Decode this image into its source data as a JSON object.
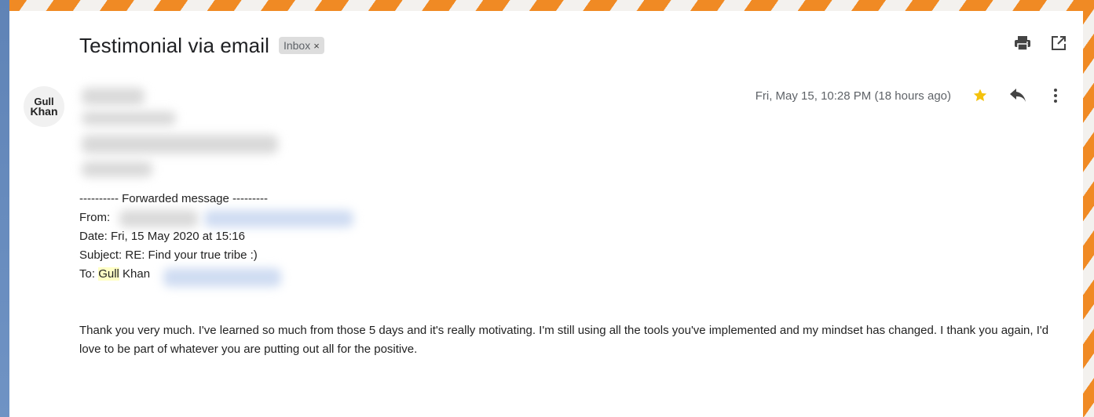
{
  "email": {
    "subject": "Testimonial via email",
    "label_chip": "Inbox",
    "label_remove": "×",
    "timestamp": "Fri, May 15, 10:28 PM (18 hours ago)",
    "avatar": {
      "line1": "Gull",
      "line2": "Khan"
    },
    "forwarded_header": "---------- Forwarded message ---------",
    "from_label": "From:",
    "date_line": "Date: Fri, 15 May 2020 at 15:16",
    "subject_line": "Subject: RE: Find your true tribe :)",
    "to_label": "To: ",
    "to_first": "Gull",
    "to_last": " Khan",
    "body": "Thank you very much. I've learned so much from those 5 days and it's really motivating. I'm still using all the tools you've implemented and my mindset has changed. I thank you again, I'd love to be part of whatever you are putting out all for the positive."
  },
  "icons": {
    "print": "print-icon",
    "open_new": "open-in-new-window-icon",
    "star": "star-icon",
    "reply": "reply-icon",
    "more": "more-vert-icon"
  },
  "colors": {
    "star": "#f4c20d",
    "highlight": "#ffffc6",
    "chip_bg": "#dddddd"
  }
}
